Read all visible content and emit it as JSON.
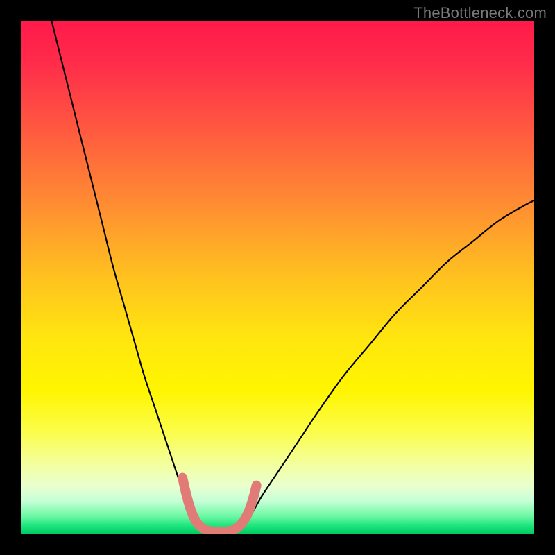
{
  "watermark": "TheBottleneck.com",
  "chart_data": {
    "type": "line",
    "title": "",
    "xlabel": "",
    "ylabel": "",
    "xlim": [
      0,
      100
    ],
    "ylim": [
      0,
      100
    ],
    "grid": false,
    "legend": false,
    "background_gradient": {
      "stops": [
        {
          "offset": 0.0,
          "color": "#ff1a4b"
        },
        {
          "offset": 0.08,
          "color": "#ff2b4a"
        },
        {
          "offset": 0.2,
          "color": "#ff5541"
        },
        {
          "offset": 0.35,
          "color": "#ff8a33"
        },
        {
          "offset": 0.5,
          "color": "#ffc21f"
        },
        {
          "offset": 0.62,
          "color": "#ffe60f"
        },
        {
          "offset": 0.72,
          "color": "#fff500"
        },
        {
          "offset": 0.8,
          "color": "#fbfd4a"
        },
        {
          "offset": 0.86,
          "color": "#f4ff9a"
        },
        {
          "offset": 0.905,
          "color": "#eaffce"
        },
        {
          "offset": 0.935,
          "color": "#c7ffd6"
        },
        {
          "offset": 0.965,
          "color": "#6cf8a4"
        },
        {
          "offset": 0.985,
          "color": "#18e37a"
        },
        {
          "offset": 1.0,
          "color": "#00c95f"
        }
      ]
    },
    "series": [
      {
        "name": "curve-left",
        "stroke": "#000000",
        "stroke_width": 2.2,
        "points": [
          {
            "x": 6,
            "y": 100
          },
          {
            "x": 8,
            "y": 92
          },
          {
            "x": 10,
            "y": 84
          },
          {
            "x": 12,
            "y": 76
          },
          {
            "x": 14,
            "y": 68
          },
          {
            "x": 16,
            "y": 60
          },
          {
            "x": 18,
            "y": 52
          },
          {
            "x": 20,
            "y": 45
          },
          {
            "x": 22,
            "y": 38
          },
          {
            "x": 24,
            "y": 31
          },
          {
            "x": 26,
            "y": 25
          },
          {
            "x": 28,
            "y": 19
          },
          {
            "x": 30,
            "y": 13
          },
          {
            "x": 31,
            "y": 10
          },
          {
            "x": 32,
            "y": 7
          },
          {
            "x": 33,
            "y": 4.5
          },
          {
            "x": 34,
            "y": 2.5
          },
          {
            "x": 35,
            "y": 1.2
          },
          {
            "x": 36,
            "y": 0.6
          },
          {
            "x": 37,
            "y": 0.4
          }
        ]
      },
      {
        "name": "curve-right",
        "stroke": "#000000",
        "stroke_width": 2.2,
        "points": [
          {
            "x": 41,
            "y": 0.4
          },
          {
            "x": 42,
            "y": 0.6
          },
          {
            "x": 43,
            "y": 1.2
          },
          {
            "x": 44,
            "y": 2.5
          },
          {
            "x": 45,
            "y": 4.0
          },
          {
            "x": 47,
            "y": 7.5
          },
          {
            "x": 50,
            "y": 12
          },
          {
            "x": 54,
            "y": 18
          },
          {
            "x": 58,
            "y": 24
          },
          {
            "x": 63,
            "y": 31
          },
          {
            "x": 68,
            "y": 37
          },
          {
            "x": 73,
            "y": 43
          },
          {
            "x": 78,
            "y": 48
          },
          {
            "x": 83,
            "y": 53
          },
          {
            "x": 88,
            "y": 57
          },
          {
            "x": 93,
            "y": 61
          },
          {
            "x": 98,
            "y": 64
          },
          {
            "x": 100,
            "y": 65
          }
        ]
      },
      {
        "name": "trough",
        "stroke": "#e07b77",
        "stroke_width": 14,
        "linecap": "round",
        "points": [
          {
            "x": 31.5,
            "y": 11
          },
          {
            "x": 32.3,
            "y": 7.5
          },
          {
            "x": 33.2,
            "y": 4.5
          },
          {
            "x": 34.2,
            "y": 2.4
          },
          {
            "x": 35.5,
            "y": 1.1
          },
          {
            "x": 37.0,
            "y": 0.6
          },
          {
            "x": 38.8,
            "y": 0.5
          },
          {
            "x": 40.5,
            "y": 0.6
          },
          {
            "x": 42.0,
            "y": 1.1
          },
          {
            "x": 43.2,
            "y": 2.3
          },
          {
            "x": 44.3,
            "y": 4.2
          },
          {
            "x": 45.2,
            "y": 6.8
          },
          {
            "x": 45.9,
            "y": 9.5
          }
        ]
      }
    ],
    "markers": [
      {
        "x": 31.7,
        "y": 9.5,
        "r": 6.0,
        "color": "#e07b77"
      },
      {
        "x": 33.0,
        "y": 5.0,
        "r": 6.0,
        "color": "#e07b77"
      },
      {
        "x": 45.0,
        "y": 5.8,
        "r": 6.0,
        "color": "#e07b77"
      },
      {
        "x": 45.8,
        "y": 8.8,
        "r": 6.0,
        "color": "#e07b77"
      }
    ]
  }
}
